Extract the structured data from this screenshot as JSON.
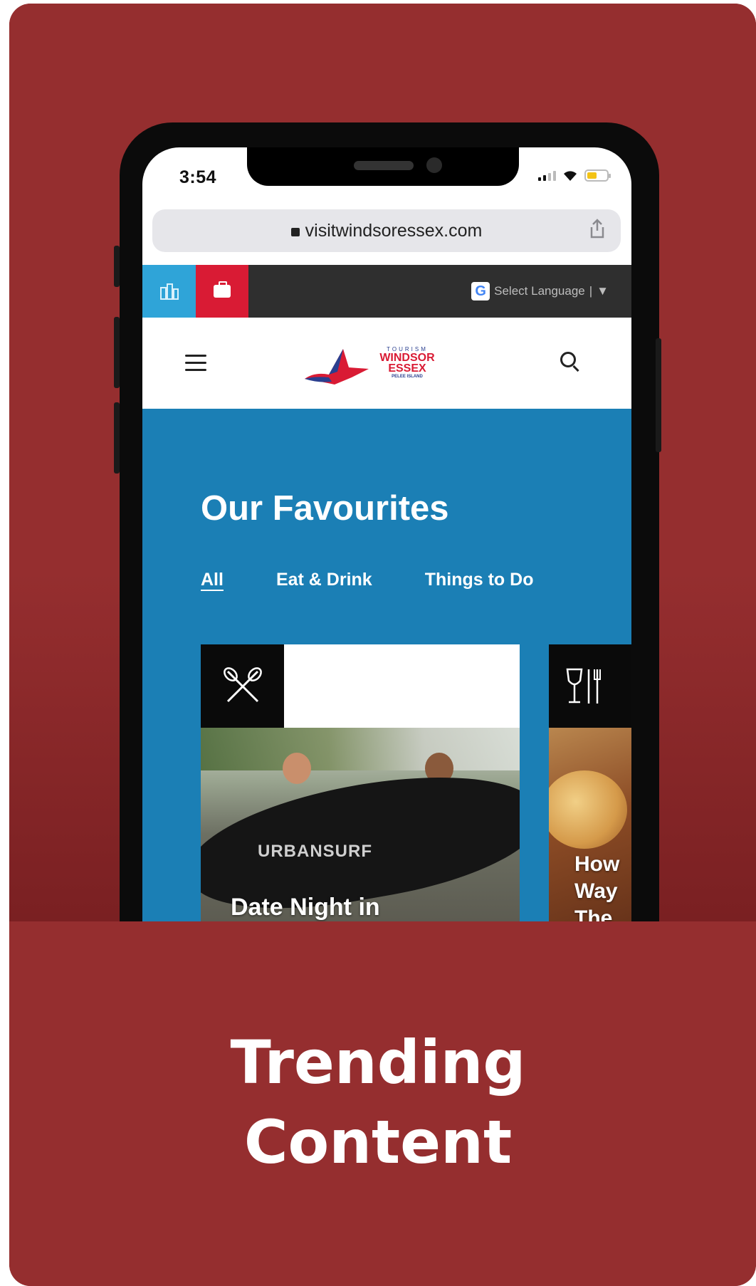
{
  "phone": {
    "status_bar": {
      "time": "3:54",
      "icons": [
        "signal-icon",
        "wifi-icon",
        "battery-icon"
      ],
      "battery_level": 0.5
    },
    "browser": {
      "url": "visitwindsoressex.com",
      "icons": [
        "lock-icon",
        "share-icon"
      ]
    },
    "utility_bar": {
      "map_icon": "map-icon",
      "work_icon": "briefcase-icon",
      "language_label": "Select Language",
      "language_icon": "google-g-icon",
      "google_letter": "G"
    },
    "site_header": {
      "menu_icon": "hamburger-menu-icon",
      "search_icon": "search-icon",
      "logo": {
        "line1": "TOURISM",
        "line2": "WINDSOR",
        "line3": "ESSEX",
        "line4": "PELEE ISLAND"
      }
    },
    "favourites": {
      "title": "Our Favourites",
      "tabs": [
        {
          "label": "All",
          "active": true
        },
        {
          "label": "Eat & Drink",
          "active": false
        },
        {
          "label": "Things to Do",
          "active": false
        }
      ],
      "cards": [
        {
          "icon": "crossed-paddles-icon",
          "board_text": "URBANSURF",
          "title": "Date Night in"
        },
        {
          "icon": "wine-utensils-icon",
          "title_lines": [
            "How",
            "Way",
            "The"
          ]
        }
      ]
    }
  },
  "headline": {
    "line1": "Trending",
    "line2": "Content"
  },
  "colors": {
    "card_bg": "#952e2f",
    "site_blue": "#1b7fb5",
    "map_blue": "#2fa4d8",
    "work_red": "#d91b34"
  }
}
